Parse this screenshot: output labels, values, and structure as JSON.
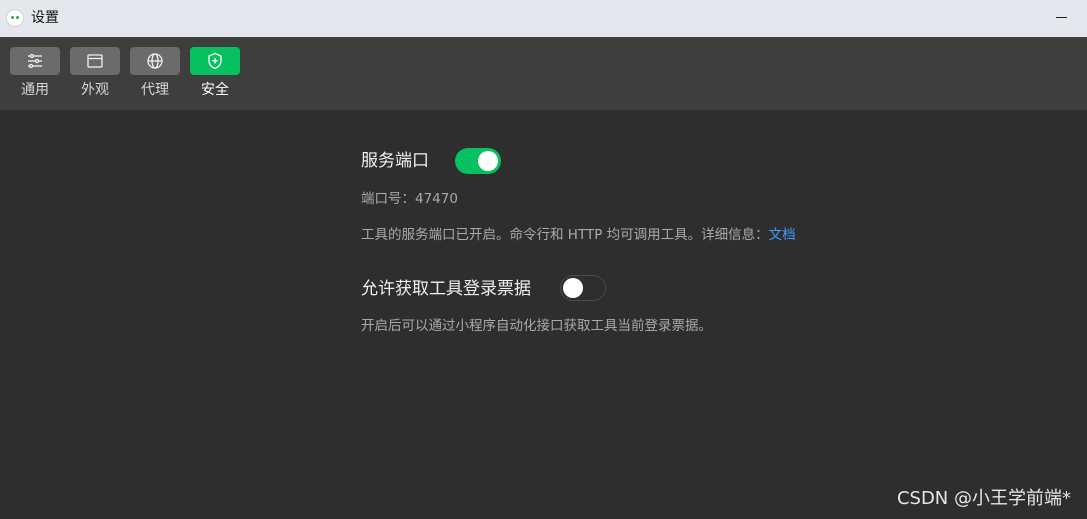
{
  "window": {
    "title": "设置",
    "logo_icon": "wechat-devtools-icon",
    "minimize_icon": "minimize-icon"
  },
  "toolbar": {
    "tabs": [
      {
        "label": "通用",
        "icon": "sliders-icon",
        "active": false
      },
      {
        "label": "外观",
        "icon": "window-icon",
        "active": false
      },
      {
        "label": "代理",
        "icon": "globe-icon",
        "active": false
      },
      {
        "label": "安全",
        "icon": "shield-icon",
        "active": true
      }
    ]
  },
  "security": {
    "service_port": {
      "title": "服务端口",
      "enabled": true,
      "port_text": "端口号：47470",
      "description": "工具的服务端口已开启。命令行和 HTTP 均可调用工具。详细信息：",
      "doc_link": "文档"
    },
    "login_ticket": {
      "title": "允许获取工具登录票据",
      "enabled": false,
      "description": "开启后可以通过小程序自动化接口获取工具当前登录票据。"
    }
  },
  "watermark": "CSDN @小王学前端*",
  "colors": {
    "accent": "#07c160",
    "link": "#3aa0ff",
    "background": "#2e2e2e",
    "toolbar": "#3e3e3e",
    "titlebar": "#e4e7ec"
  }
}
